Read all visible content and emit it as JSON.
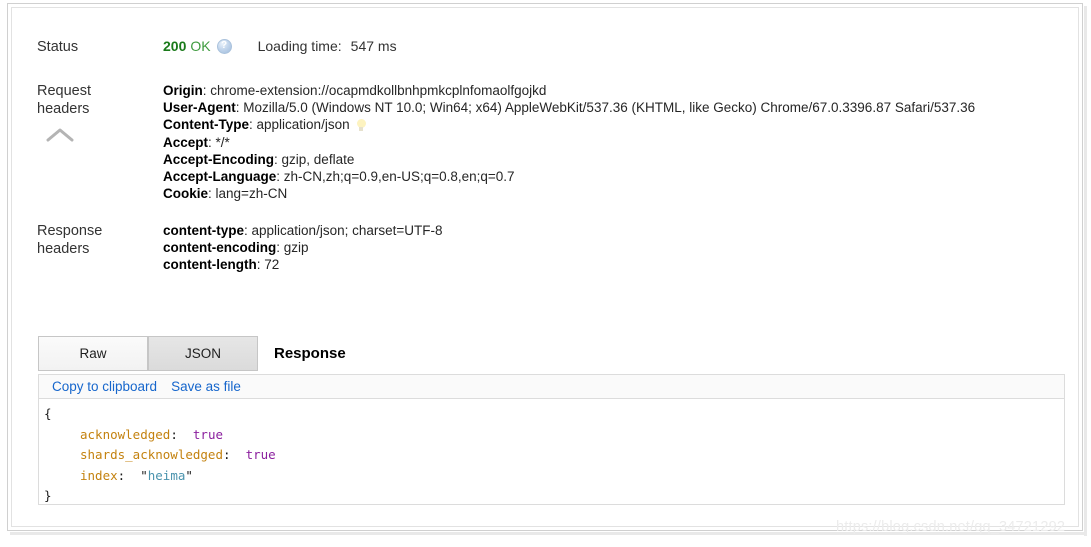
{
  "status": {
    "label": "Status",
    "code": "200",
    "text": "OK",
    "help_icon": "help-circle-icon",
    "loading_label": "Loading time:",
    "loading_value": "547 ms",
    "code_color": "#1a7a1a",
    "text_color": "#3f9b3f"
  },
  "request_headers": {
    "label_line1": "Request",
    "label_line2": "headers",
    "collapse_icon": "chevron-up-icon",
    "lines": [
      {
        "name": "Origin",
        "value": "chrome-extension://ocapmdkollbnhpmkcplnfomaolfgojkd",
        "icon": ""
      },
      {
        "name": "User-Agent",
        "value": "Mozilla/5.0 (Windows NT 10.0; Win64; x64) AppleWebKit/537.36 (KHTML, like Gecko) Chrome/67.0.3396.87 Safari/537.36",
        "icon": ""
      },
      {
        "name": "Content-Type",
        "value": "application/json",
        "icon": "lightbulb-icon"
      },
      {
        "name": "Accept",
        "value": "*/*",
        "icon": ""
      },
      {
        "name": "Accept-Encoding",
        "value": "gzip, deflate",
        "icon": ""
      },
      {
        "name": "Accept-Language",
        "value": "zh-CN,zh;q=0.9,en-US;q=0.8,en;q=0.7",
        "icon": ""
      },
      {
        "name": "Cookie",
        "value": "lang=zh-CN",
        "icon": ""
      }
    ]
  },
  "response_headers": {
    "label_line1": "Response",
    "label_line2": "headers",
    "lines": [
      {
        "name": "content-type",
        "value": "application/json; charset=UTF-8"
      },
      {
        "name": "content-encoding",
        "value": "gzip"
      },
      {
        "name": "content-length",
        "value": "72"
      }
    ]
  },
  "tabs": {
    "raw_label": "Raw",
    "json_label": "JSON",
    "active": "JSON",
    "response_heading": "Response"
  },
  "toolbar": {
    "copy_label": "Copy to clipboard",
    "save_label": "Save as file",
    "link_color": "#1666cc"
  },
  "json_body": {
    "open_brace": "{",
    "close_brace": "}",
    "entries": [
      {
        "key": "acknowledged",
        "colon": ":",
        "value": "true",
        "type": "bool"
      },
      {
        "key": "shards_acknowledged",
        "colon": ":",
        "value": "true",
        "type": "bool"
      },
      {
        "key": "index",
        "colon": ":",
        "value": "heima",
        "type": "string"
      }
    ],
    "key_color": "#c4820f",
    "bool_color": "#8b1f9e",
    "string_color": "#4a93ad"
  },
  "watermark": {
    "text": "https://blog.csdn.net/qq_34721292"
  }
}
